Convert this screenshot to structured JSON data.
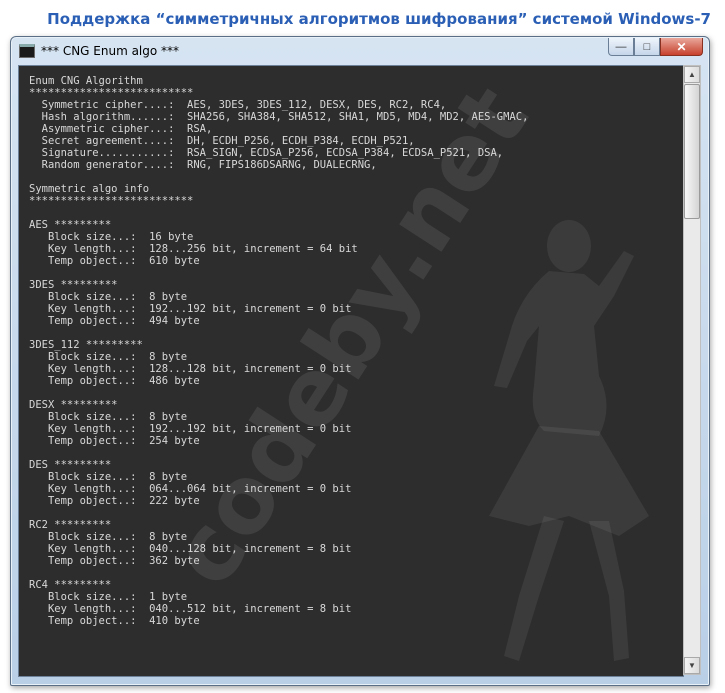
{
  "caption": "Поддержка “симметричных алгоритмов шифрования” системой Windows-7",
  "window": {
    "title": "*** CNG Enum algo ***",
    "controls": {
      "minimize": "—",
      "maximize": "□",
      "close": "✕"
    }
  },
  "watermark": "codeby.net",
  "console_lines": [
    "Enum CNG Algorithm",
    "**************************",
    "  Symmetric cipher....:  AES, 3DES, 3DES_112, DESX, DES, RC2, RC4,",
    "  Hash algorithm......:  SHA256, SHA384, SHA512, SHA1, MD5, MD4, MD2, AES-GMAC,",
    "  Asymmetric cipher...:  RSA,",
    "  Secret agreement....:  DH, ECDH_P256, ECDH_P384, ECDH_P521,",
    "  Signature...........:  RSA_SIGN, ECDSA_P256, ECDSA_P384, ECDSA_P521, DSA,",
    "  Random generator....:  RNG, FIPS186DSARNG, DUALECRNG,",
    "",
    "Symmetric algo info",
    "**************************",
    "",
    "AES *********",
    "   Block size...:  16 byte",
    "   Key length...:  128...256 bit, increment = 64 bit",
    "   Temp object..:  610 byte",
    "",
    "3DES *********",
    "   Block size...:  8 byte",
    "   Key length...:  192...192 bit, increment = 0 bit",
    "   Temp object..:  494 byte",
    "",
    "3DES_112 *********",
    "   Block size...:  8 byte",
    "   Key length...:  128...128 bit, increment = 0 bit",
    "   Temp object..:  486 byte",
    "",
    "DESX *********",
    "   Block size...:  8 byte",
    "   Key length...:  192...192 bit, increment = 0 bit",
    "   Temp object..:  254 byte",
    "",
    "DES *********",
    "   Block size...:  8 byte",
    "   Key length...:  064...064 bit, increment = 0 bit",
    "   Temp object..:  222 byte",
    "",
    "RC2 *********",
    "   Block size...:  8 byte",
    "   Key length...:  040...128 bit, increment = 8 bit",
    "   Temp object..:  362 byte",
    "",
    "RC4 *********",
    "   Block size...:  1 byte",
    "   Key length...:  040...512 bit, increment = 8 bit",
    "   Temp object..:  410 byte"
  ],
  "icons": {
    "app": "console-app-icon",
    "up": "scroll-up-arrow-icon",
    "down": "scroll-down-arrow-icon"
  },
  "colors": {
    "console_bg": "#2d2d2d",
    "console_text": "#d8d8d8",
    "caption": "#2a5fb5"
  }
}
